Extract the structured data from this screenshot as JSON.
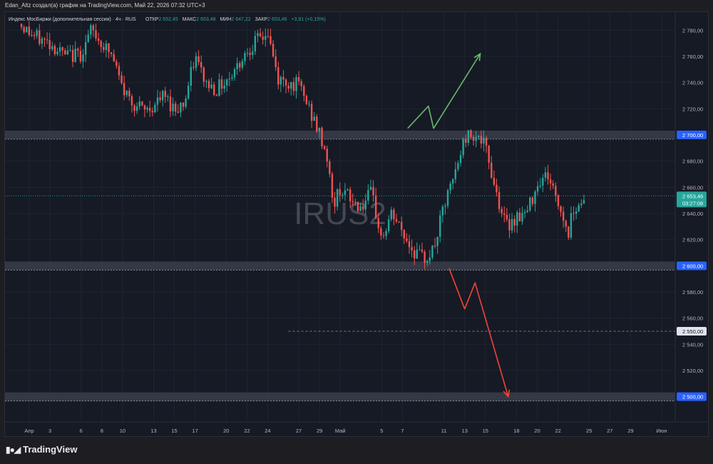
{
  "header": {
    "attribution": "Edan_Altz создал(а) график на TradingView.com, Май 22, 2026 07:32 UTC+3"
  },
  "legend": {
    "symbol": "Индекс МосБиржи (дополнительная сессия) · 4ч · RUS",
    "open_label": "ОТКР",
    "open_value": "2 652,45",
    "high_label": "МАКС",
    "high_value": "2 653,48",
    "low_label": "МИН",
    "low_value": "2 647,22",
    "close_label": "ЗАКР",
    "close_value": "2 653,46",
    "change": "+3,91 (+0,15%)"
  },
  "watermark": "IRUS2",
  "footer": {
    "brand": "TradingView"
  },
  "colors": {
    "up": "#26a69a",
    "down": "#ef5350",
    "background": "#161a25",
    "grid": "#1f2430",
    "text": "#b2b5be",
    "zone": "#3a3e4a",
    "arrow_up": "#66bb6a",
    "arrow_down": "#f44336"
  },
  "chart_data": {
    "type": "candlestick",
    "title": "Индекс МосБиржи (дополнительная сессия) · 4ч · RUS",
    "timeframe": "4ч",
    "ylim": [
      2490,
      2790
    ],
    "y_ticks": [
      2500,
      2520,
      2540,
      2560,
      2580,
      2600,
      2620,
      2640,
      2660,
      2680,
      2700,
      2720,
      2740,
      2760,
      2780
    ],
    "y_tick_labels": [
      "2 500,00",
      "2 520,00",
      "2 540,00",
      "2 560,00",
      "2 580,00",
      "2 600,00",
      "2 620,00",
      "2 640,00",
      "2 660,00",
      "2 680,00",
      "2 700,00",
      "2 720,00",
      "2 740,00",
      "2 760,00",
      "2 780,00"
    ],
    "x_labels": [
      {
        "label": "Апр",
        "day": 0
      },
      {
        "label": "3",
        "day": 2
      },
      {
        "label": "6",
        "day": 5
      },
      {
        "label": "8",
        "day": 7
      },
      {
        "label": "10",
        "day": 9
      },
      {
        "label": "13",
        "day": 12
      },
      {
        "label": "15",
        "day": 14
      },
      {
        "label": "17",
        "day": 16
      },
      {
        "label": "20",
        "day": 19
      },
      {
        "label": "22",
        "day": 21
      },
      {
        "label": "24",
        "day": 23
      },
      {
        "label": "27",
        "day": 26
      },
      {
        "label": "29",
        "day": 28
      },
      {
        "label": "Май",
        "day": 30
      },
      {
        "label": "5",
        "day": 34
      },
      {
        "label": "7",
        "day": 36
      },
      {
        "label": "11",
        "day": 40
      },
      {
        "label": "13",
        "day": 42
      },
      {
        "label": "15",
        "day": 44
      },
      {
        "label": "18",
        "day": 47
      },
      {
        "label": "20",
        "day": 49
      },
      {
        "label": "22",
        "day": 51
      },
      {
        "label": "25",
        "day": 54
      },
      {
        "label": "27",
        "day": 56
      },
      {
        "label": "29",
        "day": 58
      },
      {
        "label": "Июн",
        "day": 61
      }
    ],
    "price_path": [
      [
        -1,
        2785
      ],
      [
        0.5,
        2775
      ],
      [
        2,
        2770
      ],
      [
        3.5,
        2760
      ],
      [
        5,
        2762
      ],
      [
        6,
        2780
      ],
      [
        7,
        2770
      ],
      [
        8,
        2760
      ],
      [
        9,
        2735
      ],
      [
        10,
        2725
      ],
      [
        11,
        2718
      ],
      [
        12,
        2722
      ],
      [
        13,
        2730
      ],
      [
        14,
        2720
      ],
      [
        15,
        2725
      ],
      [
        16,
        2760
      ],
      [
        17,
        2740
      ],
      [
        18,
        2735
      ],
      [
        19,
        2742
      ],
      [
        20,
        2752
      ],
      [
        21,
        2765
      ],
      [
        22,
        2772
      ],
      [
        23,
        2778
      ],
      [
        24,
        2742
      ],
      [
        25,
        2740
      ],
      [
        26,
        2738
      ],
      [
        27,
        2720
      ],
      [
        28,
        2700
      ],
      [
        28.7,
        2685
      ],
      [
        29.3,
        2645
      ],
      [
        30,
        2660
      ],
      [
        31,
        2650
      ],
      [
        32,
        2645
      ],
      [
        33,
        2655
      ],
      [
        34,
        2620
      ],
      [
        35,
        2640
      ],
      [
        36,
        2625
      ],
      [
        37,
        2612
      ],
      [
        38,
        2605
      ],
      [
        39,
        2612
      ],
      [
        40,
        2645
      ],
      [
        41,
        2668
      ],
      [
        42,
        2698
      ],
      [
        43,
        2702
      ],
      [
        44,
        2690
      ],
      [
        45,
        2658
      ],
      [
        46,
        2630
      ],
      [
        47,
        2638
      ],
      [
        48,
        2640
      ],
      [
        49,
        2664
      ],
      [
        50,
        2670
      ],
      [
        51,
        2648
      ],
      [
        52,
        2625
      ],
      [
        52.5,
        2645
      ],
      [
        53.5,
        2650
      ]
    ],
    "levels": [
      {
        "price": 2700,
        "label": "2 700,00",
        "style": "zone"
      },
      {
        "price": 2600,
        "label": "2 600,00",
        "style": "zone"
      },
      {
        "price": 2500,
        "label": "2 500,00",
        "style": "zone"
      },
      {
        "price": 2550,
        "label": "2 550,00",
        "style": "dashed"
      }
    ],
    "current_price": {
      "value": 2653.46,
      "label": "2 653,46",
      "countdown": "03:27:08"
    },
    "drawings": [
      {
        "color": "#66bb6a",
        "points": [
          [
            36.5,
            2705
          ],
          [
            38.5,
            2722
          ],
          [
            39,
            2705
          ],
          [
            43.5,
            2762
          ]
        ]
      },
      {
        "color": "#f44336",
        "points": [
          [
            40.5,
            2598
          ],
          [
            42,
            2567
          ],
          [
            43,
            2587
          ],
          [
            46.2,
            2500
          ]
        ]
      }
    ]
  }
}
